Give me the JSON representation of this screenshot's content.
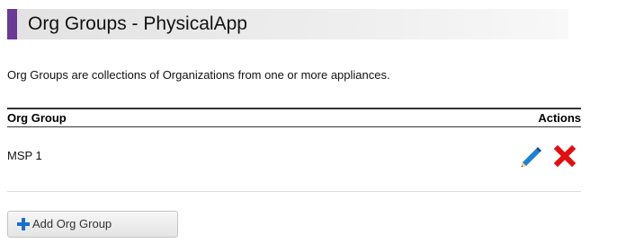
{
  "header": {
    "title": "Org Groups - PhysicalApp",
    "accent_color": "#6a3a95"
  },
  "description": "Org Groups are collections of Organizations from one or more appliances.",
  "table": {
    "columns": [
      "Org Group",
      "Actions"
    ],
    "rows": [
      {
        "name": "MSP 1",
        "actions": [
          "pencil-icon",
          "delete-x-icon"
        ]
      }
    ]
  },
  "add_button": {
    "label": "Add Org Group",
    "icon": "plus-icon",
    "icon_color": "#1a6fc9"
  },
  "colors": {
    "edit_icon": "#1f7fd4",
    "delete_icon": "#e01010"
  }
}
